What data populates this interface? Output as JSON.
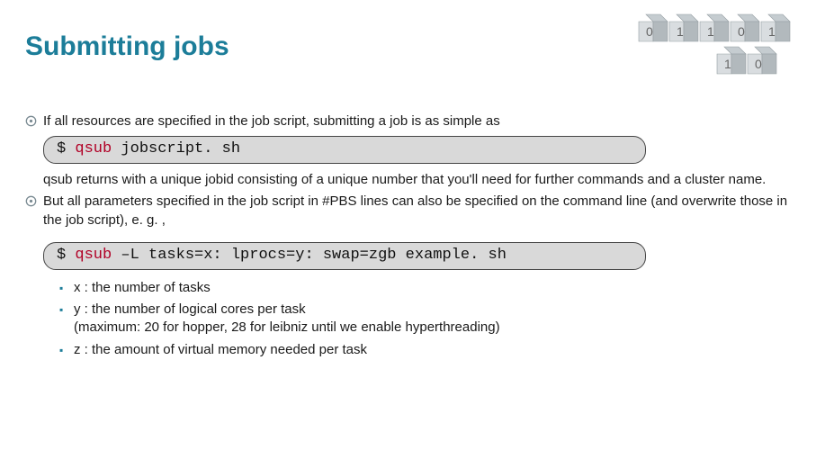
{
  "title": "Submitting jobs",
  "bullets": {
    "b1": "If all resources are specified in the job script, submitting a job is as simple as",
    "b1_cont": "qsub returns with a unique jobid consisting of a unique number that you'll need for further commands and a cluster name.",
    "b2": "But all parameters specified in the job script in #PBS lines can also be specified on the command line (and overwrite those in the job script), e. g. ,"
  },
  "code1": {
    "prompt": "$ ",
    "cmd": "qsub",
    "args": " jobscript. sh"
  },
  "code2": {
    "prompt": "$ ",
    "cmd": "qsub",
    "args": " –L tasks=x: lprocs=y: swap=zgb example. sh"
  },
  "sub": {
    "s1": "x : the number of tasks",
    "s2a": "y : the number of logical cores per task",
    "s2b": "(maximum: 20 for hopper, 28 for leibniz until we enable hyperthreading)",
    "s3": "z : the amount of virtual memory needed per task"
  }
}
